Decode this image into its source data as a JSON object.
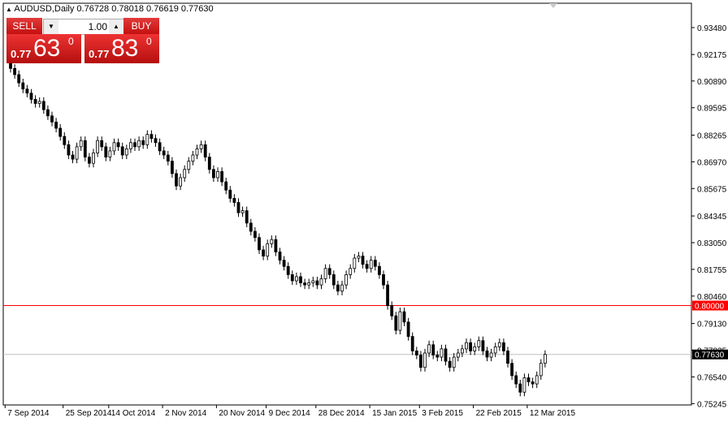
{
  "header": {
    "symbol": "AUDUSD,Daily",
    "values": "0.76728 0.78018 0.76619 0.77630"
  },
  "trade_panel": {
    "sell_label": "SELL",
    "buy_label": "BUY",
    "lots": "1.00",
    "sell_prefix": "0.77",
    "sell_big": "63",
    "sell_sup": "0",
    "buy_prefix": "0.77",
    "buy_big": "83",
    "buy_sup": "0"
  },
  "chart_data": {
    "type": "candlestick",
    "title": "AUDUSD,Daily",
    "ylim": [
      0.7518,
      0.9466
    ],
    "y_ticks": [
      "0.93480",
      "0.92175",
      "0.90890",
      "0.89595",
      "0.88265",
      "0.86970",
      "0.85675",
      "0.84345",
      "0.83050",
      "0.81755",
      "0.80460",
      "0.79130",
      "0.77835",
      "0.76540",
      "0.75245"
    ],
    "x_ticks": [
      {
        "label": "7 Sep 2014",
        "bar": 3
      },
      {
        "label": "25 Sep 2014",
        "bar": 17
      },
      {
        "label": "14 Oct 2014",
        "bar": 28
      },
      {
        "label": "2 Nov 2014",
        "bar": 41
      },
      {
        "label": "20 Nov 2014",
        "bar": 54
      },
      {
        "label": "9 Dec 2014",
        "bar": 66
      },
      {
        "label": "28 Dec 2014",
        "bar": 78
      },
      {
        "label": "15 Jan 2015",
        "bar": 91
      },
      {
        "label": "3 Feb 2015",
        "bar": 103
      },
      {
        "label": "22 Feb 2015",
        "bar": 116
      },
      {
        "label": "12 Mar 2015",
        "bar": 129
      }
    ],
    "closes": [
      0.915,
      0.912,
      0.908,
      0.905,
      0.903,
      0.9,
      0.898,
      0.899,
      0.895,
      0.892,
      0.889,
      0.886,
      0.882,
      0.878,
      0.873,
      0.871,
      0.877,
      0.88,
      0.872,
      0.869,
      0.874,
      0.88,
      0.877,
      0.872,
      0.875,
      0.879,
      0.877,
      0.873,
      0.876,
      0.879,
      0.877,
      0.88,
      0.878,
      0.883,
      0.881,
      0.879,
      0.875,
      0.873,
      0.87,
      0.864,
      0.858,
      0.862,
      0.866,
      0.87,
      0.873,
      0.876,
      0.878,
      0.872,
      0.866,
      0.862,
      0.865,
      0.86,
      0.856,
      0.852,
      0.85,
      0.845,
      0.846,
      0.84,
      0.836,
      0.833,
      0.827,
      0.824,
      0.83,
      0.832,
      0.826,
      0.822,
      0.819,
      0.815,
      0.812,
      0.814,
      0.811,
      0.81,
      0.811,
      0.812,
      0.81,
      0.813,
      0.818,
      0.815,
      0.81,
      0.807,
      0.81,
      0.815,
      0.818,
      0.823,
      0.824,
      0.82,
      0.818,
      0.822,
      0.819,
      0.815,
      0.81,
      0.8,
      0.795,
      0.788,
      0.797,
      0.792,
      0.785,
      0.778,
      0.776,
      0.77,
      0.777,
      0.781,
      0.776,
      0.775,
      0.779,
      0.773,
      0.77,
      0.775,
      0.777,
      0.779,
      0.782,
      0.778,
      0.78,
      0.783,
      0.778,
      0.775,
      0.777,
      0.78,
      0.782,
      0.778,
      0.772,
      0.766,
      0.762,
      0.758,
      0.765,
      0.763,
      0.762,
      0.766,
      0.772,
      0.7763
    ],
    "first_open": 0.918,
    "wick": 0.002,
    "levels": [
      {
        "label": "0.80000",
        "value": 0.8,
        "color": "#ff0000"
      },
      {
        "label": "0.77630",
        "value": 0.7763,
        "color": "#c0c0c0",
        "tag_bg": "#000000"
      }
    ]
  }
}
